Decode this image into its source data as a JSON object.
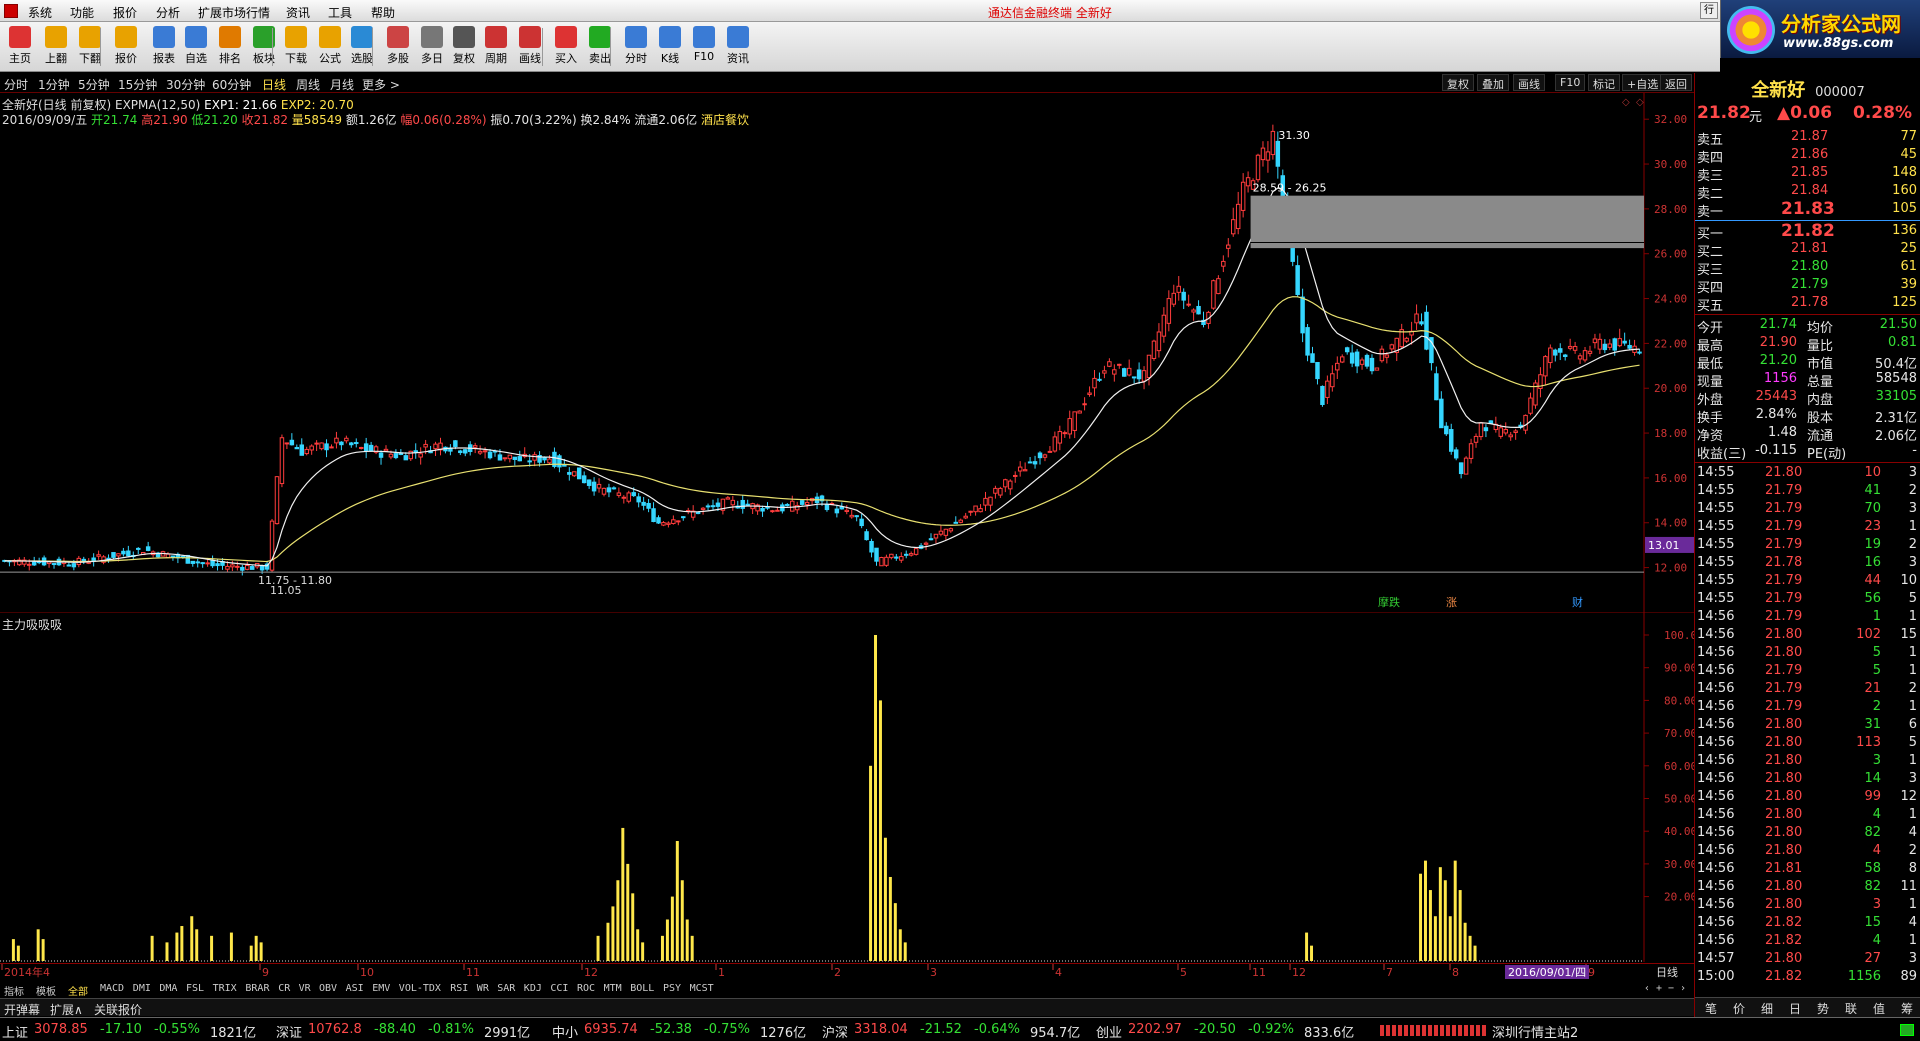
{
  "menu": {
    "items": [
      "系统",
      "功能",
      "报价",
      "分析",
      "扩展市场行情",
      "资讯",
      "工具",
      "帮助"
    ],
    "center_title": "通达信金融终端  全新好",
    "window_btn": "行"
  },
  "toolbar": {
    "items": [
      {
        "label": "主页",
        "color": "#d33"
      },
      {
        "label": "上翻",
        "color": "#e8a200"
      },
      {
        "label": "下翻",
        "color": "#e8a200"
      },
      {
        "label": "报价",
        "color": "#e8a200"
      },
      {
        "label": "报表",
        "color": "#3a7bd5"
      },
      {
        "label": "自选",
        "color": "#3a7bd5"
      },
      {
        "label": "排名",
        "color": "#e07a00"
      },
      {
        "label": "板块",
        "color": "#2aa02a"
      },
      {
        "label": "下载",
        "color": "#e8a200"
      },
      {
        "label": "公式",
        "color": "#e8a200"
      },
      {
        "label": "选股",
        "color": "#2a8ad5"
      },
      {
        "label": "多股",
        "color": "#c44"
      },
      {
        "label": "多日",
        "color": "#777"
      },
      {
        "label": "复权",
        "color": "#555"
      },
      {
        "label": "周期",
        "color": "#c33"
      },
      {
        "label": "画线",
        "color": "#c33"
      },
      {
        "label": "买入",
        "color": "#d33"
      },
      {
        "label": "卖出",
        "color": "#2a2"
      },
      {
        "label": "分时",
        "color": "#3a7bd5"
      },
      {
        "label": "K线",
        "color": "#3a7bd5"
      },
      {
        "label": "F10",
        "color": "#3a7bd5"
      },
      {
        "label": "资讯",
        "color": "#3a7bd5"
      }
    ]
  },
  "ad": {
    "title": "分析家公式网",
    "url": "www.88gs.com"
  },
  "periods": {
    "items": [
      "分时",
      "1分钟",
      "5分钟",
      "15分钟",
      "30分钟",
      "60分钟",
      "日线",
      "周线",
      "月线",
      "更多 >"
    ],
    "active": "日线"
  },
  "chart_controls": [
    "复权",
    "叠加",
    "画线",
    "F10",
    "标记",
    "+自选",
    "返回"
  ],
  "info": {
    "line1": {
      "name": "全新好(日线 前复权) EXPMA(12,50)",
      "exp1": "EXP1: 21.66",
      "exp2": "EXP2: 20.70"
    },
    "line2": {
      "date": "2016/09/09/五",
      "open": "开21.74",
      "high": "高21.90",
      "low": "低21.20",
      "close": "收21.82",
      "vol": "量58549",
      "amt": "额1.26亿",
      "chg": "幅0.06(0.28%)",
      "amp": "振0.70(3.22%)",
      "turn": "换2.84%",
      "float": "流通2.06亿",
      "industry": "酒店餐饮"
    }
  },
  "main_annotations": {
    "high": "31.30",
    "zone": "28.59 - 26.25",
    "low": "11.75 - 11.80",
    "low2": "11.05",
    "price_tag": "13.01",
    "markers": [
      "摩跌",
      "涨",
      "财"
    ]
  },
  "sub_title": "主力吸吸吸",
  "chart_data": [
    {
      "type": "candlestick",
      "title": "全新好(日线 前复权)",
      "ylim": [
        11,
        32.5
      ],
      "yticks": [
        "32.00",
        "30.00",
        "28.00",
        "26.00",
        "24.00",
        "22.00",
        "20.00",
        "18.00",
        "16.00",
        "14.00",
        "12.00"
      ],
      "anchors": [
        [
          0,
          12.3
        ],
        [
          14,
          12.2
        ],
        [
          28,
          12.8
        ],
        [
          42,
          12.1
        ],
        [
          53,
          12.0
        ],
        [
          56,
          17.8
        ],
        [
          60,
          17.2
        ],
        [
          68,
          17.6
        ],
        [
          72,
          17.3
        ],
        [
          80,
          17.0
        ],
        [
          88,
          17.5
        ],
        [
          96,
          17.2
        ],
        [
          104,
          16.8
        ],
        [
          110,
          16.9
        ],
        [
          120,
          15.5
        ],
        [
          128,
          15.0
        ],
        [
          132,
          14.0
        ],
        [
          138,
          14.4
        ],
        [
          146,
          14.9
        ],
        [
          156,
          14.6
        ],
        [
          164,
          15.0
        ],
        [
          172,
          14.2
        ],
        [
          176,
          12.2
        ],
        [
          184,
          12.8
        ],
        [
          196,
          14.6
        ],
        [
          206,
          16.5
        ],
        [
          214,
          18.0
        ],
        [
          222,
          21.0
        ],
        [
          230,
          20.5
        ],
        [
          236,
          24.5
        ],
        [
          242,
          23.0
        ],
        [
          250,
          28.8
        ],
        [
          256,
          31.3
        ],
        [
          262,
          22.5
        ],
        [
          266,
          19.5
        ],
        [
          270,
          21.6
        ],
        [
          276,
          21.0
        ],
        [
          282,
          22.3
        ],
        [
          286,
          23.2
        ],
        [
          290,
          18.5
        ],
        [
          294,
          16.2
        ],
        [
          298,
          18.5
        ],
        [
          302,
          18.0
        ],
        [
          306,
          18.3
        ],
        [
          312,
          21.8
        ],
        [
          318,
          21.5
        ],
        [
          322,
          22.0
        ],
        [
          330,
          21.82
        ]
      ],
      "series": [
        {
          "name": "EXP1",
          "value": "21.66"
        },
        {
          "name": "EXP2",
          "value": "20.70"
        }
      ]
    },
    {
      "type": "bar",
      "title": "主力吸吸吸",
      "ylim": [
        0,
        100
      ],
      "yticks": [
        "100.00",
        "90.00",
        "80.00",
        "70.00",
        "60.00",
        "50.00",
        "40.00",
        "30.00",
        "20.00"
      ],
      "spikes": [
        [
          2,
          7
        ],
        [
          3,
          5
        ],
        [
          7,
          10
        ],
        [
          8,
          7
        ],
        [
          30,
          8
        ],
        [
          33,
          6
        ],
        [
          35,
          9
        ],
        [
          36,
          11
        ],
        [
          38,
          14
        ],
        [
          39,
          10
        ],
        [
          42,
          8
        ],
        [
          46,
          9
        ],
        [
          50,
          5
        ],
        [
          51,
          8
        ],
        [
          52,
          6
        ],
        [
          120,
          8
        ],
        [
          122,
          12
        ],
        [
          123,
          17
        ],
        [
          124,
          25
        ],
        [
          125,
          41
        ],
        [
          126,
          30
        ],
        [
          127,
          21
        ],
        [
          128,
          10
        ],
        [
          129,
          6
        ],
        [
          133,
          8
        ],
        [
          134,
          13
        ],
        [
          135,
          20
        ],
        [
          136,
          37
        ],
        [
          137,
          25
        ],
        [
          138,
          13
        ],
        [
          139,
          8
        ],
        [
          175,
          60
        ],
        [
          176,
          100
        ],
        [
          177,
          80
        ],
        [
          178,
          38
        ],
        [
          179,
          26
        ],
        [
          180,
          18
        ],
        [
          181,
          10
        ],
        [
          182,
          6
        ],
        [
          263,
          9
        ],
        [
          264,
          5
        ],
        [
          286,
          27
        ],
        [
          287,
          31
        ],
        [
          288,
          22
        ],
        [
          289,
          14
        ],
        [
          290,
          29
        ],
        [
          291,
          25
        ],
        [
          292,
          14
        ],
        [
          293,
          31
        ],
        [
          294,
          22
        ],
        [
          295,
          12
        ],
        [
          296,
          8
        ],
        [
          297,
          5
        ]
      ]
    }
  ],
  "date_axis": {
    "labels": [
      "2014年4",
      "9",
      "10",
      "11",
      "12",
      "1",
      "2",
      "3",
      "4",
      "5",
      "11",
      "12",
      "7",
      "8",
      "9"
    ],
    "current": "2016/09/01/四",
    "right": "日线"
  },
  "indicator_tabs": {
    "items": [
      "指标",
      "模板",
      "全部",
      "MACD",
      "DMI",
      "DMA",
      "FSL",
      "TRIX",
      "BRAR",
      "CR",
      "VR",
      "OBV",
      "ASI",
      "EMV",
      "VOL-TDX",
      "RSI",
      "WR",
      "SAR",
      "KDJ",
      "CCI",
      "ROC",
      "MTM",
      "BOLL",
      "PSY",
      "MCST"
    ],
    "active": "全部"
  },
  "bottom_tabs": [
    "开弹幕",
    "扩展∧",
    "关联报价"
  ],
  "status": [
    {
      "name": "上证",
      "val": "3078.85",
      "chg": "-17.10",
      "pct": "-0.55%",
      "amt": "1821亿"
    },
    {
      "name": "深证",
      "val": "10762.8",
      "chg": "-88.40",
      "pct": "-0.81%",
      "amt": "2991亿"
    },
    {
      "name": "中小",
      "val": "6935.74",
      "chg": "-52.38",
      "pct": "-0.75%",
      "amt": "1276亿"
    },
    {
      "name": "沪深",
      "val": "3318.04",
      "chg": "-21.52",
      "pct": "-0.64%",
      "amt": "954.7亿"
    },
    {
      "name": "创业",
      "val": "2202.97",
      "chg": "-20.50",
      "pct": "-0.92%",
      "amt": "833.6亿"
    }
  ],
  "status_right": "深圳行情主站2",
  "quote": {
    "name": "全新好",
    "code": "000007",
    "price": "21.82",
    "unit": "元",
    "change": "▲0.06",
    "pct": "0.28%",
    "asks": [
      {
        "l": "卖五",
        "p": "21.87",
        "v": "77"
      },
      {
        "l": "卖四",
        "p": "21.86",
        "v": "45"
      },
      {
        "l": "卖三",
        "p": "21.85",
        "v": "148"
      },
      {
        "l": "卖二",
        "p": "21.84",
        "v": "160"
      },
      {
        "l": "卖一",
        "p": "21.83",
        "v": "105"
      }
    ],
    "bids": [
      {
        "l": "买一",
        "p": "21.82",
        "v": "136"
      },
      {
        "l": "买二",
        "p": "21.81",
        "v": "25"
      },
      {
        "l": "买三",
        "p": "21.80",
        "v": "61"
      },
      {
        "l": "买四",
        "p": "21.79",
        "v": "39"
      },
      {
        "l": "买五",
        "p": "21.78",
        "v": "125"
      }
    ],
    "stats": [
      {
        "a": "今开",
        "av": "21.74",
        "ac": "grn",
        "b": "均价",
        "bv": "21.50",
        "bc": "grn"
      },
      {
        "a": "最高",
        "av": "21.90",
        "ac": "red",
        "b": "量比",
        "bv": "0.81",
        "bc": "grn"
      },
      {
        "a": "最低",
        "av": "21.20",
        "ac": "grn",
        "b": "市值",
        "bv": "50.4亿",
        "bc": "wht"
      },
      {
        "a": "现量",
        "av": "1156",
        "ac": "mag",
        "b": "总量",
        "bv": "58548",
        "bc": "wht"
      },
      {
        "a": "外盘",
        "av": "25443",
        "ac": "red",
        "b": "内盘",
        "bv": "33105",
        "bc": "grn"
      },
      {
        "a": "换手",
        "av": "2.84%",
        "ac": "wht",
        "b": "股本",
        "bv": "2.31亿",
        "bc": "wht"
      },
      {
        "a": "净资",
        "av": "1.48",
        "ac": "wht",
        "b": "流通",
        "bv": "2.06亿",
        "bc": "wht"
      },
      {
        "a": "收益(三)",
        "av": "-0.115",
        "ac": "wht",
        "b": "PE(动)",
        "bv": "-",
        "bc": "wht"
      }
    ],
    "ticks": [
      [
        "14:55",
        "21.80",
        "10",
        "3"
      ],
      [
        "14:55",
        "21.79",
        "41",
        "2"
      ],
      [
        "14:55",
        "21.79",
        "70",
        "3"
      ],
      [
        "14:55",
        "21.79",
        "23",
        "1"
      ],
      [
        "14:55",
        "21.79",
        "19",
        "2"
      ],
      [
        "14:55",
        "21.78",
        "16",
        "3"
      ],
      [
        "14:55",
        "21.79",
        "44",
        "10"
      ],
      [
        "14:55",
        "21.79",
        "56",
        "5"
      ],
      [
        "14:56",
        "21.79",
        "1",
        "1"
      ],
      [
        "14:56",
        "21.80",
        "102",
        "15"
      ],
      [
        "14:56",
        "21.80",
        "5",
        "1"
      ],
      [
        "14:56",
        "21.79",
        "5",
        "1"
      ],
      [
        "14:56",
        "21.79",
        "21",
        "2"
      ],
      [
        "14:56",
        "21.79",
        "2",
        "1"
      ],
      [
        "14:56",
        "21.80",
        "31",
        "6"
      ],
      [
        "14:56",
        "21.80",
        "113",
        "5"
      ],
      [
        "14:56",
        "21.80",
        "3",
        "1"
      ],
      [
        "14:56",
        "21.80",
        "14",
        "3"
      ],
      [
        "14:56",
        "21.80",
        "99",
        "12"
      ],
      [
        "14:56",
        "21.80",
        "4",
        "1"
      ],
      [
        "14:56",
        "21.80",
        "82",
        "4"
      ],
      [
        "14:56",
        "21.80",
        "4",
        "2"
      ],
      [
        "14:56",
        "21.81",
        "58",
        "8"
      ],
      [
        "14:56",
        "21.80",
        "82",
        "11"
      ],
      [
        "14:56",
        "21.80",
        "3",
        "1"
      ],
      [
        "14:56",
        "21.82",
        "15",
        "4"
      ],
      [
        "14:56",
        "21.82",
        "4",
        "1"
      ],
      [
        "14:57",
        "21.80",
        "27",
        "3"
      ],
      [
        "15:00",
        "21.82",
        "1156",
        "89"
      ]
    ],
    "tabs": [
      "笔",
      "价",
      "细",
      "日",
      "势",
      "联",
      "值",
      "筹"
    ]
  }
}
